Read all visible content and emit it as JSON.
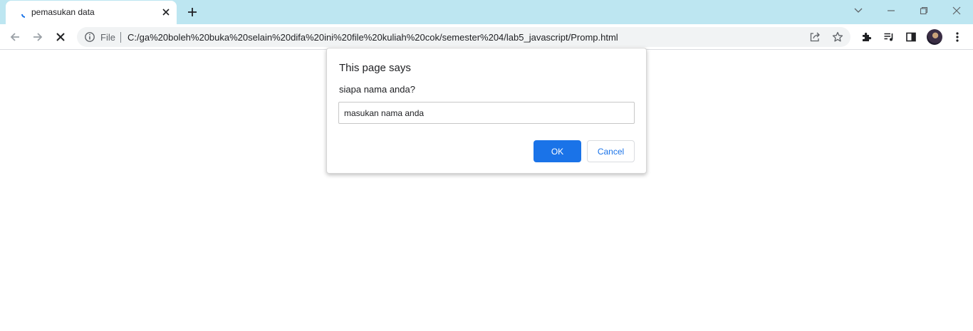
{
  "browser": {
    "tab": {
      "title": "pemasukan data",
      "favicon": "loading-spinner-icon"
    },
    "new_tab_icon": "plus-icon",
    "window_controls": [
      "chevron-down-icon",
      "minimize-icon",
      "restore-icon",
      "close-icon"
    ],
    "toolbar": {
      "back_icon": "arrow-left-icon",
      "forward_icon": "arrow-right-icon",
      "stop_icon": "stop-loading-icon",
      "site_info_icon": "info-icon",
      "scheme_label": "File",
      "url": "C:/ga%20boleh%20buka%20selain%20difa%20ini%20file%20kuliah%20cok/semester%204/lab5_javascript/Promp.html",
      "share_icon": "share-icon",
      "bookmark_icon": "star-icon",
      "extensions_icon": "puzzle-icon",
      "media_icon": "media-queue-icon",
      "side_panel_icon": "side-panel-icon",
      "menu_icon": "kebab-menu-icon"
    }
  },
  "dialog": {
    "title": "This page says",
    "message": "siapa nama anda?",
    "input_value": "masukan nama anda",
    "ok_label": "OK",
    "cancel_label": "Cancel"
  },
  "colors": {
    "tabstrip_bg": "#bde6f1",
    "accent": "#1a73e8",
    "omnibox_bg": "#f1f3f4"
  }
}
